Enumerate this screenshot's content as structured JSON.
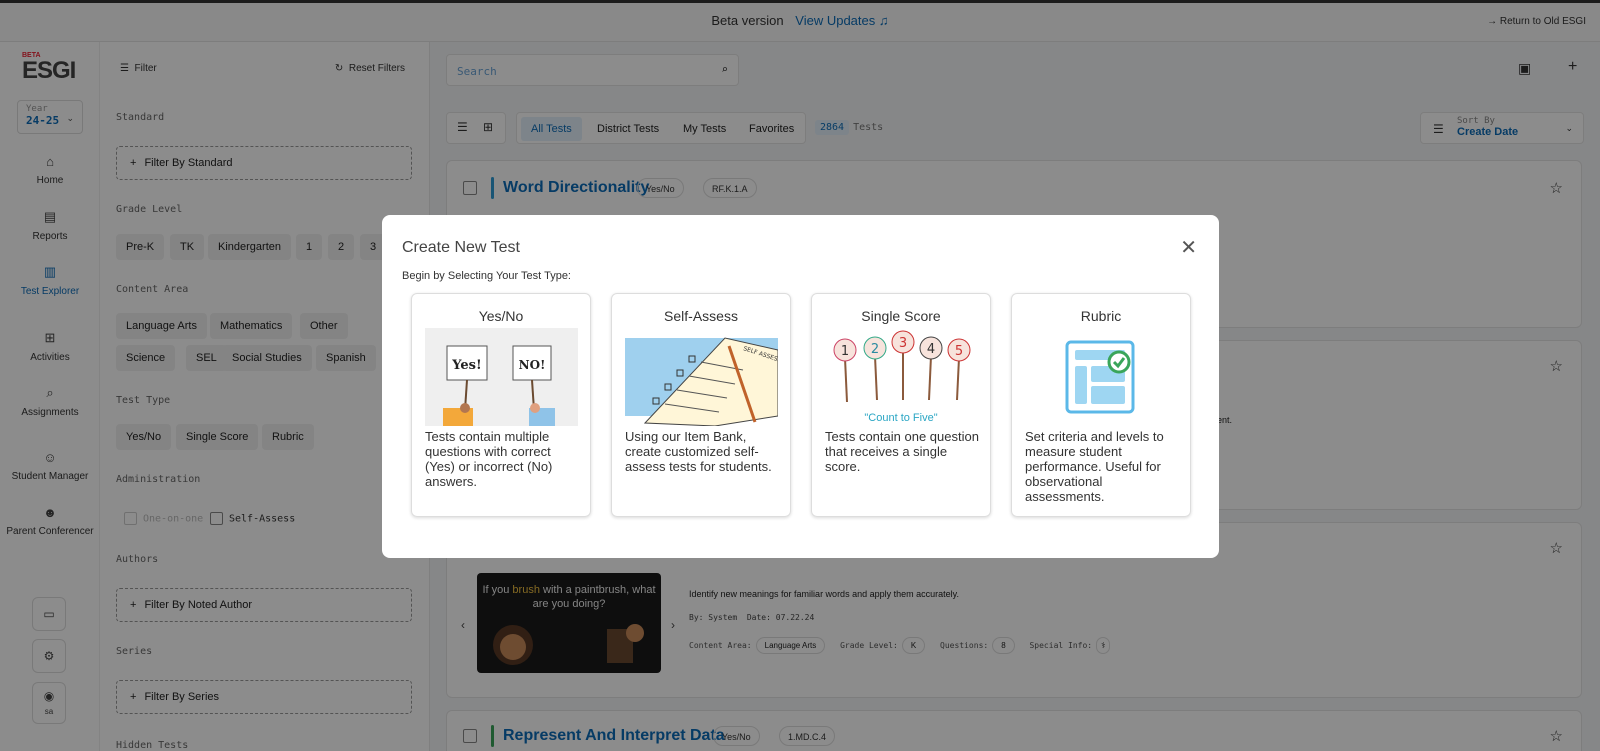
{
  "topbar": {
    "beta": "Beta version",
    "updates": "View Updates",
    "return": "Return to Old ESGI"
  },
  "nav": {
    "logo_beta": "BETA",
    "logo": "ESGI",
    "year_label": "Year",
    "year_value": "24-25",
    "items": [
      {
        "label": "Home"
      },
      {
        "label": "Reports"
      },
      {
        "label": "Test Explorer"
      },
      {
        "label": "Activities"
      },
      {
        "label": "Assignments"
      },
      {
        "label": "Student Manager"
      },
      {
        "label": "Parent Conferencer"
      }
    ],
    "user": "sa"
  },
  "filter": {
    "header": "Filter",
    "reset": "Reset Filters",
    "standard_label": "Standard",
    "standard_btn": "Filter By Standard",
    "grade_label": "Grade Level",
    "grades": [
      "Pre-K",
      "TK",
      "Kindergarten",
      "1",
      "2",
      "3"
    ],
    "content_label": "Content Area",
    "content_row1": [
      "Language Arts",
      "Mathematics",
      "Other"
    ],
    "content_row2": [
      "Science",
      "SEL",
      "Social Studies",
      "Spanish"
    ],
    "testtype_label": "Test Type",
    "testtypes": [
      "Yes/No",
      "Single Score",
      "Rubric"
    ],
    "admin_label": "Administration",
    "admin_one": "One-on-one",
    "admin_self": "Self-Assess",
    "authors_label": "Authors",
    "authors_btn": "Filter By Noted Author",
    "series_label": "Series",
    "series_btn": "Filter By Series",
    "hidden_label": "Hidden Tests"
  },
  "main": {
    "search_placeholder": "Search",
    "tabs": [
      "All Tests",
      "District Tests",
      "My Tests",
      "Favorites"
    ],
    "count": "2864",
    "count_label": "Tests",
    "sort_label": "Sort By",
    "sort_value": "Create Date",
    "card1": {
      "title": "Word Directionality",
      "tag1": "Yes/No",
      "tag2": "RF.K.1.A"
    },
    "card2": {
      "desc_tail": "ent."
    },
    "card3": {
      "thumb_pre": "If you ",
      "thumb_hl": "brush",
      "thumb_post": " with a paintbrush, what are you doing?",
      "desc": "Identify new meanings for familiar words and apply them accurately.",
      "by_label": "By:",
      "by": "System",
      "date_label": "Date:",
      "date": "07.22.24",
      "content_label": "Content Area:",
      "content": "Language Arts",
      "grade_label": "Grade Level:",
      "grade": "K",
      "questions_label": "Questions:",
      "questions": "8",
      "special_label": "Special Info:"
    },
    "card4": {
      "title": "Represent And Interpret Data",
      "tag1": "Yes/No",
      "tag2": "1.MD.C.4"
    }
  },
  "modal": {
    "title": "Create New Test",
    "subtitle": "Begin by Selecting Your Test Type:",
    "types": [
      {
        "title": "Yes/No",
        "desc": "Tests contain multiple questions with correct (Yes) or incorrect (No) answers.",
        "sign1": "Yes!",
        "sign2": "NO!"
      },
      {
        "title": "Self-Assess",
        "desc": "Using our Item Bank, create customized self-assess tests for students.",
        "sheet": "SELF ASSESSMENT"
      },
      {
        "title": "Single Score",
        "desc": "Tests contain one question that receives a single score.",
        "caption": "\"Count to Five\"",
        "nums": [
          "1",
          "2",
          "3",
          "4",
          "5"
        ]
      },
      {
        "title": "Rubric",
        "desc": "Set criteria and levels to measure student performance. Useful for observational assessments."
      }
    ]
  }
}
